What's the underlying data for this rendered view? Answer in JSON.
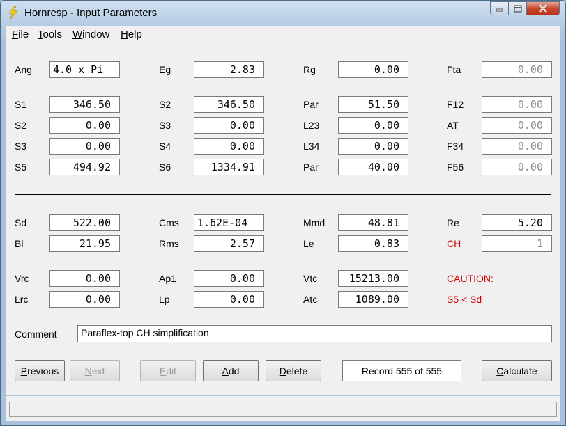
{
  "window": {
    "title": "Hornresp - Input Parameters"
  },
  "menu": [
    {
      "key": "F",
      "rest": "ile"
    },
    {
      "key": "T",
      "rest": "ools"
    },
    {
      "key": "W",
      "rest": "indow"
    },
    {
      "key": "H",
      "rest": "elp"
    }
  ],
  "params": {
    "ang": {
      "label": "Ang",
      "value": "4.0 x Pi"
    },
    "eg": {
      "label": "Eg",
      "value": "2.83"
    },
    "rg": {
      "label": "Rg",
      "value": "0.00"
    },
    "fta": {
      "label": "Fta",
      "value": "0.00"
    },
    "s1": {
      "label": "S1",
      "value": "346.50"
    },
    "s2a": {
      "label": "S2",
      "value": "346.50"
    },
    "par1": {
      "label": "Par",
      "value": "51.50"
    },
    "f12": {
      "label": "F12",
      "value": "0.00"
    },
    "s2b": {
      "label": "S2",
      "value": "0.00"
    },
    "s3a": {
      "label": "S3",
      "value": "0.00"
    },
    "l23": {
      "label": "L23",
      "value": "0.00"
    },
    "at": {
      "label": "AT",
      "value": "0.00"
    },
    "s3b": {
      "label": "S3",
      "value": "0.00"
    },
    "s4": {
      "label": "S4",
      "value": "0.00"
    },
    "l34": {
      "label": "L34",
      "value": "0.00"
    },
    "f34": {
      "label": "F34",
      "value": "0.00"
    },
    "s5": {
      "label": "S5",
      "value": "494.92"
    },
    "s6": {
      "label": "S6",
      "value": "1334.91"
    },
    "par2": {
      "label": "Par",
      "value": "40.00"
    },
    "f56": {
      "label": "F56",
      "value": "0.00"
    },
    "sd": {
      "label": "Sd",
      "value": "522.00"
    },
    "cms": {
      "label": "Cms",
      "value": "1.62E-04"
    },
    "mmd": {
      "label": "Mmd",
      "value": "48.81"
    },
    "re": {
      "label": "Re",
      "value": "5.20"
    },
    "bl": {
      "label": "Bl",
      "value": "21.95"
    },
    "rms": {
      "label": "Rms",
      "value": "2.57"
    },
    "le": {
      "label": "Le",
      "value": "0.83"
    },
    "ch": {
      "label": "CH",
      "value": "1"
    },
    "vrc": {
      "label": "Vrc",
      "value": "0.00"
    },
    "ap1": {
      "label": "Ap1",
      "value": "0.00"
    },
    "vtc": {
      "label": "Vtc",
      "value": "15213.00"
    },
    "lrc": {
      "label": "Lrc",
      "value": "0.00"
    },
    "lp": {
      "label": "Lp",
      "value": "0.00"
    },
    "atc": {
      "label": "Atc",
      "value": "1089.00"
    }
  },
  "warning": {
    "title": "CAUTION:",
    "message": "S5 < Sd",
    "color": "#d40000"
  },
  "comment": {
    "label": "Comment",
    "value": "Paraflex-top CH simplification"
  },
  "buttons": {
    "previous": {
      "key": "P",
      "rest": "revious"
    },
    "next": {
      "key": "N",
      "rest": "ext"
    },
    "edit": {
      "key": "E",
      "rest": "dit"
    },
    "add": {
      "key": "A",
      "rest": "dd"
    },
    "delete": {
      "key": "D",
      "rest": "elete"
    },
    "calculate": {
      "key": "C",
      "rest": "alculate"
    }
  },
  "record": "Record 555 of 555",
  "icons": {
    "app": "lightning-icon",
    "minimize": "minimize-icon",
    "maximize": "maximize-icon",
    "close": "close-icon"
  }
}
